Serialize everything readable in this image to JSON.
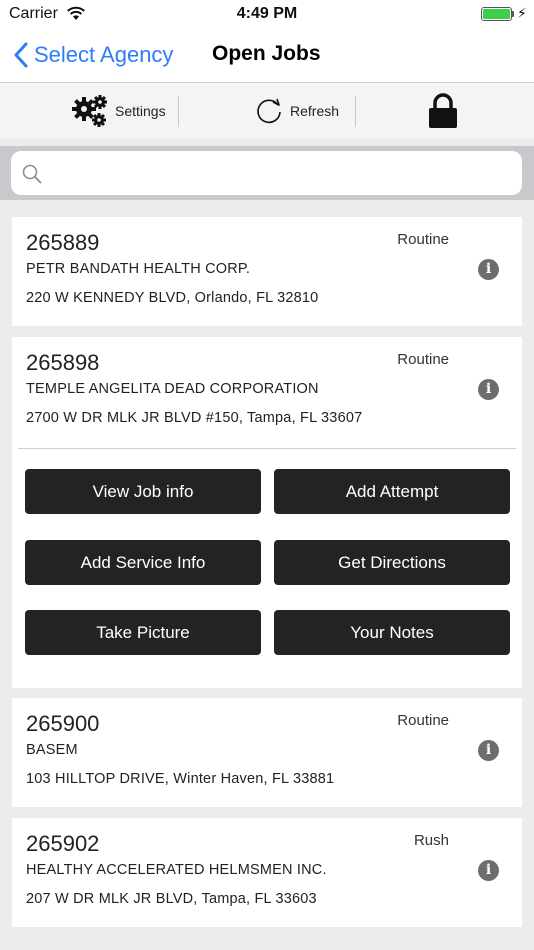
{
  "status_bar": {
    "carrier": "Carrier",
    "time": "4:49 PM",
    "battery_level": 1.0,
    "battery_color": "#3cd04a"
  },
  "nav": {
    "back_label": "Select Agency",
    "title": "Open Jobs",
    "accent_color": "#2f7cf6"
  },
  "toolbar": {
    "settings_label": "Settings",
    "settings_icon": "gears-icon",
    "refresh_label": "Refresh",
    "refresh_icon": "refresh-icon",
    "lock_icon": "lock-icon"
  },
  "search": {
    "placeholder": "",
    "value": ""
  },
  "jobs": [
    {
      "job_number": "265889",
      "priority": "Routine",
      "name": "PETR BANDATH HEALTH CORP.",
      "address": "220 W KENNEDY BLVD, Orlando, FL  32810",
      "expanded": false
    },
    {
      "job_number": "265898",
      "priority": "Routine",
      "name": "TEMPLE ANGELITA DEAD CORPORATION",
      "address": "2700 W DR MLK JR BLVD #150, Tampa, FL  33607",
      "expanded": true,
      "actions": [
        "View Job info",
        "Add Attempt",
        "Add Service Info",
        "Get Directions",
        "Take Picture",
        "Your Notes"
      ]
    },
    {
      "job_number": "265900",
      "priority": "Routine",
      "name": "BASEM",
      "address": "103 HILLTOP DRIVE, Winter Haven, FL  33881",
      "expanded": false
    },
    {
      "job_number": "265902",
      "priority": "Rush",
      "name": "HEALTHY ACCELERATED HELMSMEN INC.",
      "address": "207 W DR MLK JR BLVD, Tampa, FL  33603",
      "expanded": false
    }
  ]
}
